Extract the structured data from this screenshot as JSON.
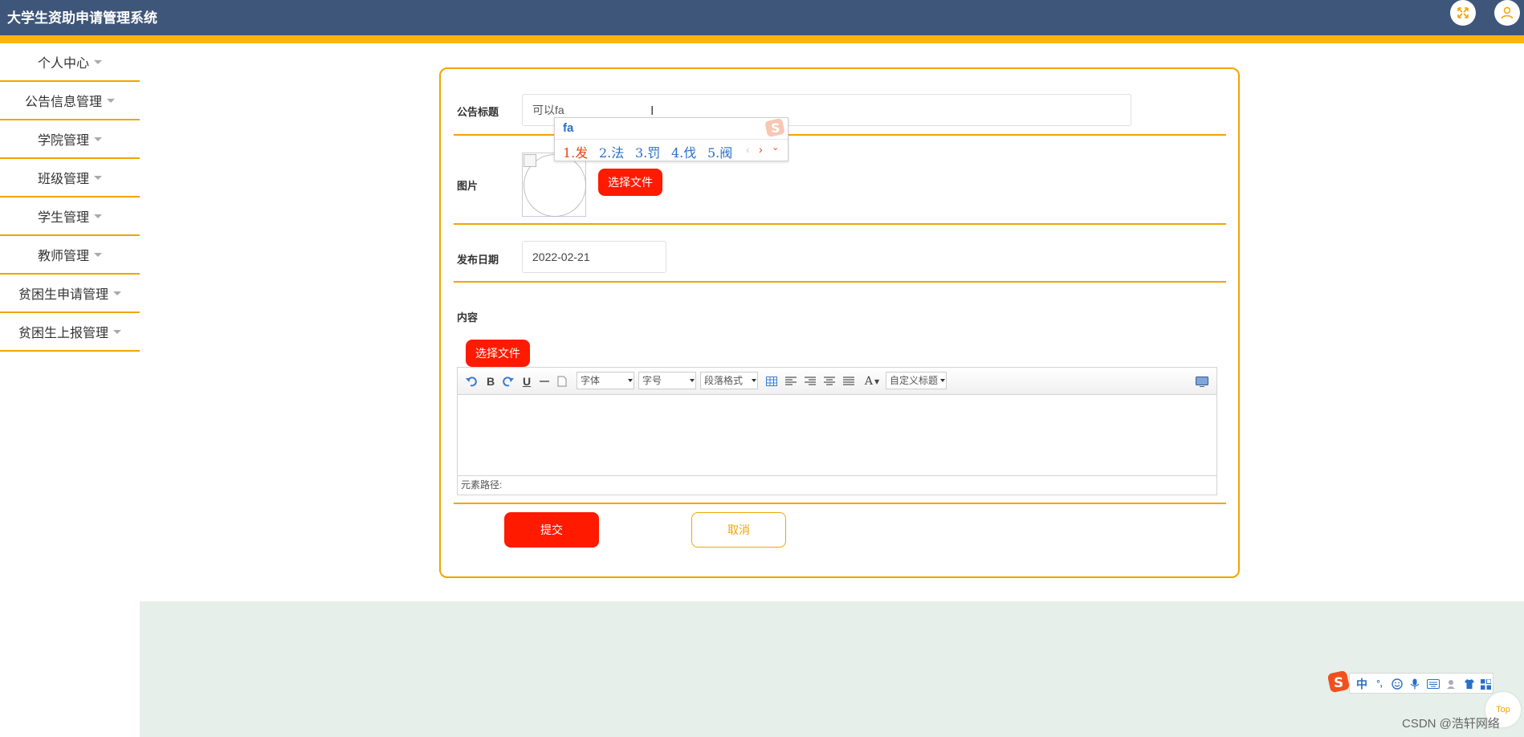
{
  "app": {
    "title": "大学生资助申请管理系统",
    "colors": {
      "header": "#3e5679",
      "accent": "#f7b50f",
      "border": "#f0a500",
      "danger": "#ff1a00"
    },
    "icons": {
      "fullscreen": "fullscreen-icon",
      "user": "user-icon"
    }
  },
  "sidebar": {
    "items": [
      {
        "label": "个人中心"
      },
      {
        "label": "公告信息管理"
      },
      {
        "label": "学院管理"
      },
      {
        "label": "班级管理"
      },
      {
        "label": "学生管理"
      },
      {
        "label": "教师管理"
      },
      {
        "label": "贫困生申请管理"
      },
      {
        "label": "贫困生上报管理"
      }
    ]
  },
  "form": {
    "title_label": "公告标题",
    "title_value": "可以fa",
    "image_label": "图片",
    "image_button": "选择文件",
    "date_label": "发布日期",
    "date_value": "2022-02-21",
    "content_label": "内容",
    "content_button": "选择文件",
    "submit": "提交",
    "cancel": "取消"
  },
  "editor": {
    "font_select": "字体",
    "size_select": "字号",
    "paragraph_select": "段落格式",
    "custom_title_select": "自定义标题",
    "bold": "B",
    "underline": "U",
    "font_color": "A",
    "element_path": "元素路径:"
  },
  "ime": {
    "composition": "fa",
    "candidates": [
      "1.发",
      "2.法",
      "3.罚",
      "4.伐",
      "5.阀"
    ],
    "bar_mode": "中",
    "bar_punct": "°,"
  },
  "footer": {
    "top_button": "Top",
    "watermark": "CSDN @浩轩网络"
  }
}
